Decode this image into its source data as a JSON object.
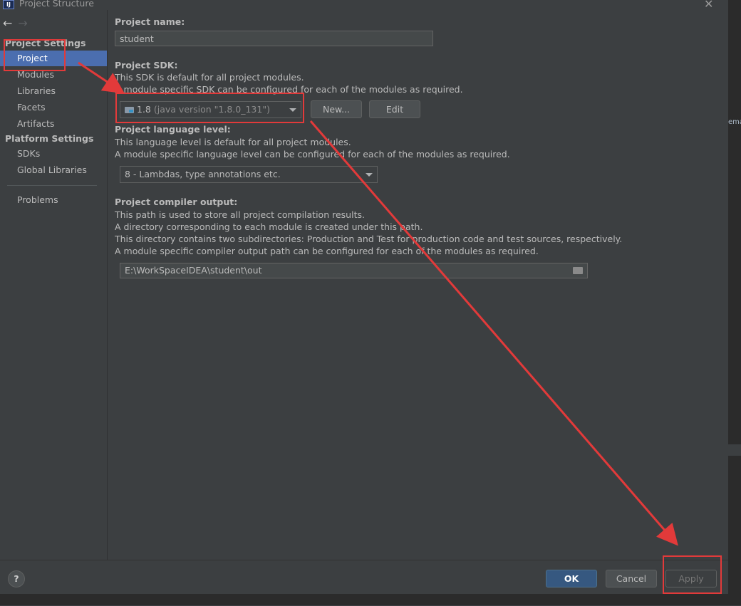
{
  "window": {
    "title": "Project Structure",
    "close_glyph": "✕",
    "app_icon_text": "IJ",
    "strip_text": "ema"
  },
  "nav": {
    "back": "←",
    "forward": "→"
  },
  "sidebar": {
    "project_settings_label": "Project Settings",
    "project_settings_items": [
      "Project",
      "Modules",
      "Libraries",
      "Facets",
      "Artifacts"
    ],
    "platform_settings_label": "Platform Settings",
    "platform_settings_items": [
      "SDKs",
      "Global Libraries"
    ],
    "problems_label": "Problems",
    "selected": "Project"
  },
  "main": {
    "project_name": {
      "label": "Project name:",
      "value": "student"
    },
    "project_sdk": {
      "label": "Project SDK:",
      "desc1": "This SDK is default for all project modules.",
      "desc2": "A module specific SDK can be configured for each of the modules as required.",
      "selected_version": "1.8",
      "selected_detail": "(java version \"1.8.0_131\")",
      "icon": "folder-sdk-icon",
      "new_label": "New...",
      "edit_label": "Edit"
    },
    "language_level": {
      "label": "Project language level:",
      "desc1": "This language level is default for all project modules.",
      "desc2": "A module specific language level can be configured for each of the modules as required.",
      "selected": "8 - Lambdas, type annotations etc."
    },
    "compiler_output": {
      "label": "Project compiler output:",
      "desc1": "This path is used to store all project compilation results.",
      "desc2": "A directory corresponding to each module is created under this path.",
      "desc3": "This directory contains two subdirectories: Production and Test for production code and test sources, respectively.",
      "desc4": "A module specific compiler output path can be configured for each of the modules as required.",
      "value": "E:\\WorkSpaceIDEA\\student\\out"
    }
  },
  "footer": {
    "help": "?",
    "ok_label": "OK",
    "cancel_label": "Cancel",
    "apply_label": "Apply"
  },
  "colors": {
    "accent": "#4b6eaf",
    "ok": "#365880",
    "annotation": "#e23a3a",
    "background": "#3c3f41"
  }
}
